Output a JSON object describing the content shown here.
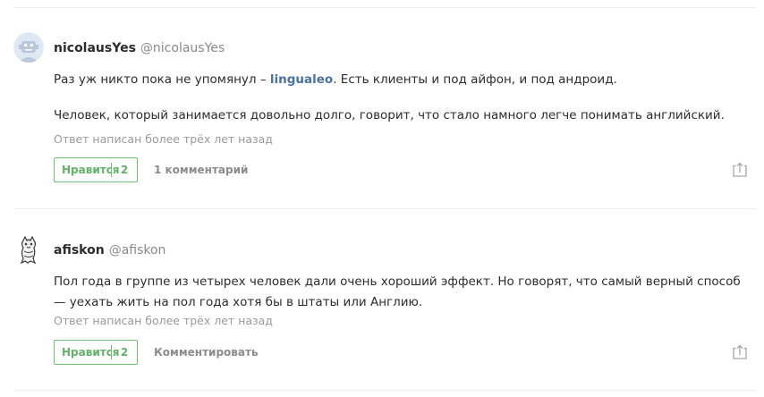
{
  "answers": [
    {
      "name": "nicolausYes",
      "handle": "@nicolausYes",
      "text_before": "Раз уж никто пока не упомянул – ",
      "link": "lingualeo",
      "text_after": ". Есть клиенты и под айфон, и под андроид.",
      "paragraph2": "Человек, который занимается довольно долго, говорит, что стало намного легче понимать английский.",
      "meta": "Ответ написан более трёх лет назад",
      "like_label": "Нравится",
      "like_count": "2",
      "action": "1 комментарий",
      "avatar_icon": "robot-avatar-icon",
      "share_icon": "share-icon"
    },
    {
      "name": "afiskon",
      "handle": "@afiskon",
      "text": "Пол года в группе из четырех человек дали очень хороший эффект. Но говорят, что самый верный способ — уехать жить на пол года хотя бы в штаты или Англию.",
      "meta": "Ответ написан более трёх лет назад",
      "like_label": "Нравится",
      "like_count": "2",
      "action": "Комментировать",
      "avatar_icon": "cat-avatar-icon",
      "share_icon": "share-icon"
    }
  ],
  "colors": {
    "like_green": "#6fbf73",
    "link_blue": "#4a72a3",
    "meta_gray": "#9a9a9a"
  }
}
